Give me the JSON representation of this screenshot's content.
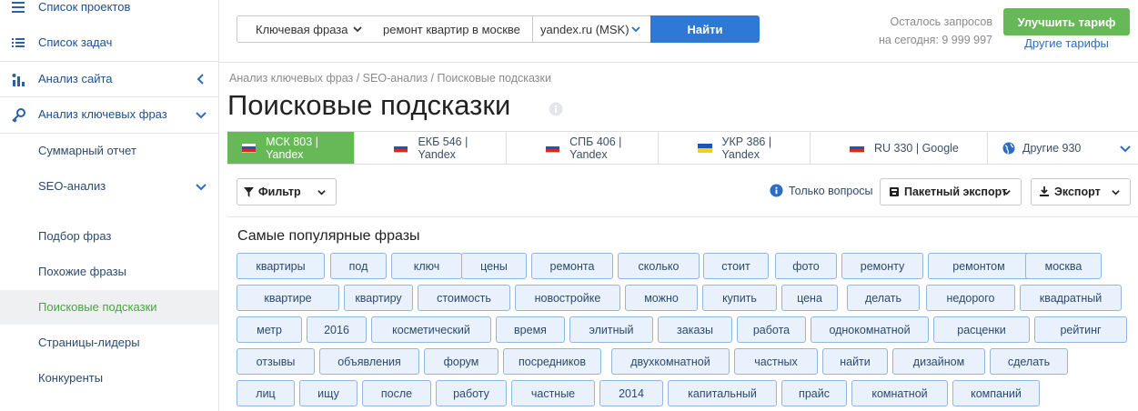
{
  "sidebar": {
    "items": [
      {
        "label": "Список проектов",
        "icon": "menu-icon"
      },
      {
        "label": "Список задач",
        "icon": "list-icon"
      },
      {
        "label": "Анализ сайта",
        "icon": "site-analysis-icon"
      },
      {
        "label": "Анализ ключевых фраз",
        "icon": "key-icon"
      },
      {
        "label": "Суммарный отчет"
      },
      {
        "label": "SEO-анализ"
      },
      {
        "label": "Подбор фраз"
      },
      {
        "label": "Похожие фразы"
      },
      {
        "label": "Поисковые подсказки"
      },
      {
        "label": "Страницы-лидеры"
      },
      {
        "label": "Конкуренты"
      }
    ]
  },
  "search": {
    "type_value": "Ключевая фраза",
    "query_value": "ремонт квартир в москве",
    "region_value": "yandex.ru (MSK)",
    "find_label": "Найти"
  },
  "quota": {
    "line1": "Осталось запросов",
    "line2": "на сегодня: 9 999 997"
  },
  "tariff": {
    "upgrade_label": "Улучшить тариф",
    "other_label": "Другие тарифы"
  },
  "breadcrumb": "Анализ ключевых фраз / SEO-анализ / Поисковые подсказки",
  "page_title": "Поисковые подсказки",
  "tabs": [
    {
      "label": "МСК 803 | Yandex",
      "flag": "ru"
    },
    {
      "label": "ЕКБ 546 | Yandex",
      "flag": "ru"
    },
    {
      "label": "СПБ 406 | Yandex",
      "flag": "ru"
    },
    {
      "label": "УКР 386 | Yandex",
      "flag": "ua"
    },
    {
      "label": "RU 330 | Google",
      "flag": "ru"
    },
    {
      "label": "Другие 930",
      "flag": "globe"
    }
  ],
  "toolbar": {
    "filter_label": "Фильтр",
    "only_questions_label": "Только вопросы",
    "batch_export_label": "Пакетный экспорт",
    "export_label": "Экспорт"
  },
  "popular": {
    "title": "Самые популярные фразы",
    "rows": [
      [
        "квартиры",
        "под",
        "ключ",
        "цены",
        "ремонта",
        "сколько",
        "стоит",
        "фото",
        "ремонту",
        "ремонтом",
        "москва"
      ],
      [
        "квартире",
        "квартиру",
        "стоимость",
        "новостройке",
        "можно",
        "купить",
        "цена",
        "делать",
        "недорого",
        "квадратный"
      ],
      [
        "метр",
        "2016",
        "косметический",
        "время",
        "элитный",
        "заказы",
        "работа",
        "однокомнатной",
        "расценки",
        "рейтинг"
      ],
      [
        "отзывы",
        "объявления",
        "форум",
        "посредников",
        "двухкомнатной",
        "частных",
        "найти",
        "дизайном",
        "сделать"
      ],
      [
        "лиц",
        "ищу",
        "после",
        "работу",
        "частные",
        "2014",
        "капитальный",
        "прайс",
        "комнатной",
        "компаний"
      ]
    ]
  },
  "colors": {
    "accent_green": "#67b857",
    "accent_blue": "#2e79d6",
    "chip_bg": "#e9f1fc",
    "chip_border": "#93b5e0"
  }
}
